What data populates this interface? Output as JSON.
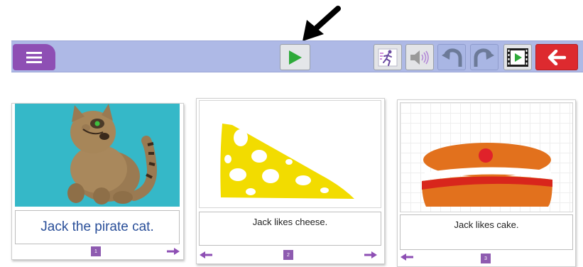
{
  "toolbar": {
    "buttons": [
      "menu",
      "play",
      "sign-language",
      "sound",
      "undo",
      "redo",
      "slideshow",
      "back"
    ]
  },
  "pages": [
    {
      "number": "1",
      "caption": "Jack the pirate cat.",
      "picture": "cat",
      "prev": false,
      "next": true
    },
    {
      "number": "2",
      "caption": "Jack likes cheese.",
      "picture": "cheese",
      "prev": true,
      "next": true
    },
    {
      "number": "3",
      "caption": "Jack likes cake.",
      "picture": "cake",
      "prev": true,
      "next": false
    }
  ],
  "colors": {
    "toolbar": "#aeb9e6",
    "menu_button": "#8e4fb4",
    "play_triangle": "#2eaa3a",
    "back_button": "#dd2a2f",
    "page_number": "#8e5bb0",
    "caption_text": "#2a4f99",
    "cat_background": "#35b8c8",
    "cheese": "#f2dc00",
    "cake": "#e2711d"
  }
}
